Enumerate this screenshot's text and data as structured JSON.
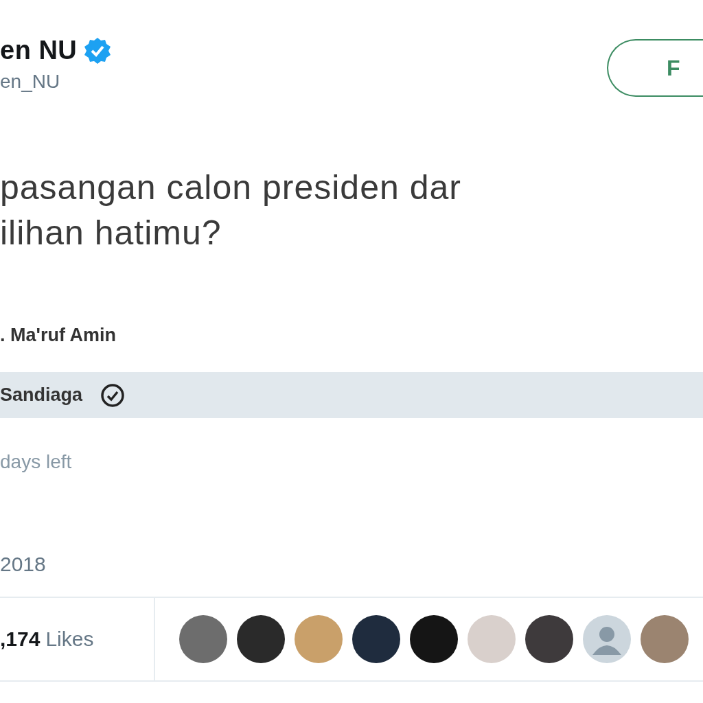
{
  "author": {
    "name": "en NU",
    "verified": true,
    "handle": "en_NU"
  },
  "follow_button": {
    "label": "F"
  },
  "tweet_text_lines": [
    "pasangan calon presiden dar",
    "ilihan hatimu?"
  ],
  "poll": {
    "options": [
      {
        "label": ". Ma'ruf Amin",
        "selected": false
      },
      {
        "label": "Sandiaga",
        "selected": true
      }
    ],
    "time_left": "days left"
  },
  "date": "2018",
  "likes": {
    "count": ",174",
    "label": "Likes"
  },
  "likers": [
    {
      "kind": "photo"
    },
    {
      "kind": "photo"
    },
    {
      "kind": "photo"
    },
    {
      "kind": "photo"
    },
    {
      "kind": "photo"
    },
    {
      "kind": "photo"
    },
    {
      "kind": "photo"
    },
    {
      "kind": "default"
    },
    {
      "kind": "photo"
    }
  ]
}
